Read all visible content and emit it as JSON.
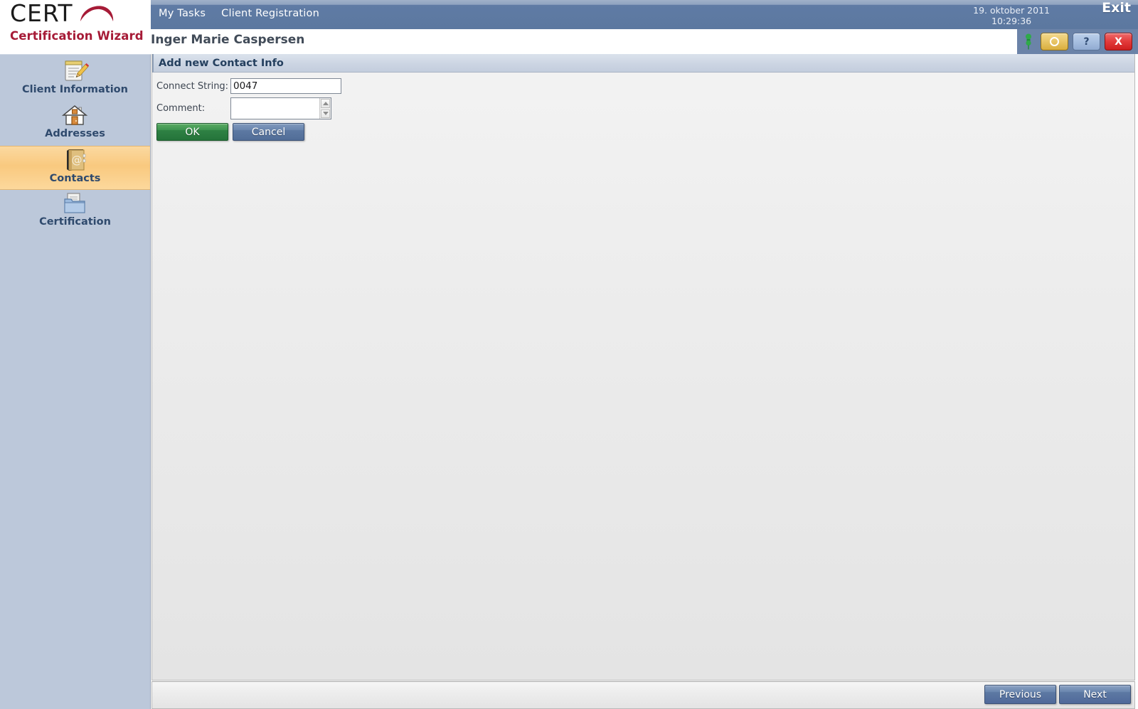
{
  "brand": {
    "logo_text": "CERT",
    "subtitle": "Certification Wizard",
    "logo_color": "#1a1a1a",
    "swoosh_color": "#a61b37",
    "subtitle_color": "#a61b37"
  },
  "topnav": {
    "items": [
      {
        "label": "My Tasks"
      },
      {
        "label": "Client Registration"
      }
    ],
    "date": "19. oktober 2011",
    "time": "10:29:36",
    "exit_label": "Exit",
    "background_color": "#5f7ba5"
  },
  "client": {
    "name": "Inger Marie Caspersen"
  },
  "toolbar": {
    "pin_icon": "pushpin-icon",
    "buttons": [
      {
        "name": "options-button",
        "icon": "circle-icon",
        "glyph": "",
        "style": "yellow"
      },
      {
        "name": "help-button",
        "icon": "question-icon",
        "glyph": "?",
        "style": "blue"
      },
      {
        "name": "close-button",
        "icon": "close-icon",
        "glyph": "X",
        "style": "red"
      }
    ]
  },
  "sidebar": {
    "background_color": "#bcc8da",
    "active_color": "#f9c97f",
    "items": [
      {
        "label": "Client Information",
        "icon": "notepad-pencil-icon",
        "active": false
      },
      {
        "label": "Addresses",
        "icon": "house-icon",
        "active": false
      },
      {
        "label": "Contacts",
        "icon": "address-book-at-icon",
        "active": true
      },
      {
        "label": "Certification",
        "icon": "folder-document-icon",
        "active": false
      }
    ]
  },
  "panel": {
    "title": "Add new Contact Info",
    "fields": {
      "connect_string_label": "Connect String:",
      "connect_string_value": "0047",
      "connect_string_placeholder": "",
      "comment_label": "Comment:",
      "comment_value": "",
      "comment_placeholder": ""
    },
    "buttons": {
      "ok_label": "OK",
      "cancel_label": "Cancel",
      "ok_color": "#2f8244",
      "cancel_color": "#5d79a3"
    }
  },
  "footer": {
    "previous_label": "Previous",
    "next_label": "Next"
  }
}
